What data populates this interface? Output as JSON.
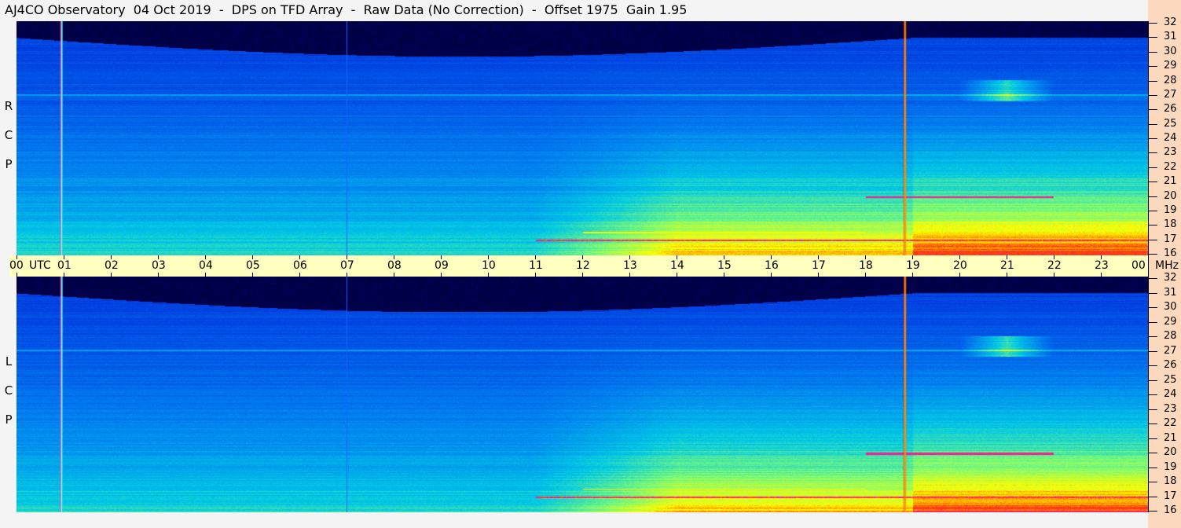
{
  "title": "AJ4CO Observatory  04 Oct 2019  -  DPS on TFD Array  -  Raw Data (No Correction)  -  Offset 1975  Gain 1.95",
  "chart_data": {
    "type": "heatmap",
    "title": "AJ4CO Observatory  04 Oct 2019  -  DPS on TFD Array  -  Raw Data (No Correction)  -  Offset 1975  Gain 1.95",
    "xlabel": "UTC",
    "ylabel": "MHz",
    "xlim": [
      0,
      24
    ],
    "ylim": [
      16,
      32
    ],
    "x_ticks": [
      "00",
      "01",
      "02",
      "03",
      "04",
      "05",
      "06",
      "07",
      "08",
      "09",
      "10",
      "11",
      "12",
      "13",
      "14",
      "15",
      "16",
      "17",
      "18",
      "19",
      "20",
      "21",
      "22",
      "23",
      "00"
    ],
    "y_ticks": [
      "16",
      "17",
      "18",
      "19",
      "20",
      "21",
      "22",
      "23",
      "24",
      "25",
      "26",
      "27",
      "28",
      "29",
      "30",
      "31",
      "32"
    ],
    "panels": [
      {
        "name": "RCP",
        "label": [
          "R",
          "C",
          "P"
        ]
      },
      {
        "name": "LCP",
        "label": [
          "L",
          "C",
          "P"
        ]
      }
    ],
    "features": {
      "vertical_lines_utc": [
        0.93,
        18.82
      ],
      "horizontal_lines_mhz": [
        27,
        20,
        17.05
      ],
      "burst_region": {
        "utc": [
          20,
          22
        ],
        "mhz": [
          26.5,
          28
        ]
      }
    }
  },
  "axis": {
    "utc_label": "UTC",
    "mhz_label": "MHz"
  },
  "colors": {
    "timebar": "#ffffc0",
    "rightaxis": "#fcd9bc"
  }
}
